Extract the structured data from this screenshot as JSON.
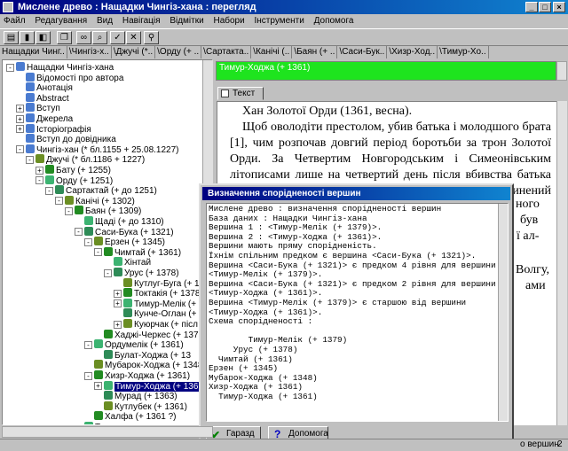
{
  "window": {
    "title": "Мислене древо : Нащадки Чингіз-хана : перегляд",
    "controls": [
      "_",
      "□",
      "×"
    ]
  },
  "menu": [
    "Файл",
    "Редагування",
    "Вид",
    "Навігація",
    "Відмітки",
    "Набори",
    "Інструменти",
    "Допомога"
  ],
  "tabs": [
    "Нащадки Чинг..",
    "\\Чингіз-х..",
    "\\Джучі (*..",
    "\\Орду (+ ..",
    "\\Сартакта..",
    "\\Канічі (..",
    "\\Баян (+ ..",
    "\\Саси-Бук..",
    "\\Хизр-Ход..",
    "\\Тимур-Хо.."
  ],
  "tree": {
    "items": [
      {
        "label": "Нащадки Чингіз-хана",
        "depth": 0,
        "exp": "-"
      },
      {
        "label": "Відомості про автора",
        "depth": 1
      },
      {
        "label": "Анотація",
        "depth": 1
      },
      {
        "label": "Abstract",
        "depth": 1
      },
      {
        "label": "Вступ",
        "depth": 1,
        "exp": "+"
      },
      {
        "label": "Джерела",
        "depth": 1,
        "exp": "+"
      },
      {
        "label": "Історіографія",
        "depth": 1,
        "exp": "+"
      },
      {
        "label": "Вступ до довідника",
        "depth": 1
      },
      {
        "label": "Чингіз-хан (* бл.1155 + 25.08.1227)",
        "depth": 1,
        "exp": "-"
      },
      {
        "label": "Джучі (* бл.1186 + 1227)",
        "depth": 2,
        "exp": "-"
      },
      {
        "label": "Бату (+ 1255)",
        "depth": 3,
        "exp": "+"
      },
      {
        "label": "Орду (+ 1251)",
        "depth": 3,
        "exp": "-"
      },
      {
        "label": "Сартактай (+ до 1251)",
        "depth": 4,
        "exp": "-"
      },
      {
        "label": "Канічі (+ 1302)",
        "depth": 5,
        "exp": "-"
      },
      {
        "label": "Баян (+ 1309)",
        "depth": 6,
        "exp": "-"
      },
      {
        "label": "Щаді (+ до 1310)",
        "depth": 7
      },
      {
        "label": "Саси-Бука (+ 1321)",
        "depth": 7,
        "exp": "-"
      },
      {
        "label": "Ерзен (+ 1345)",
        "depth": 8,
        "exp": "-"
      },
      {
        "label": "Чимтай (+ 1361)",
        "depth": 9,
        "exp": "-"
      },
      {
        "label": "Хінтай",
        "depth": 10
      },
      {
        "label": "Урус (+ 1378)",
        "depth": 10,
        "exp": "-"
      },
      {
        "label": "Кутлуг-Буга (+ 1361",
        "depth": 11
      },
      {
        "label": "Токтакія (+ 1378",
        "depth": 11,
        "exp": "+"
      },
      {
        "label": "Тимур-Мелік (+ 1379",
        "depth": 11,
        "exp": "+"
      },
      {
        "label": "Кунче-Оглан (+",
        "depth": 11
      },
      {
        "label": "Куюрчак (+ післ",
        "depth": 11,
        "exp": "+"
      },
      {
        "label": "Хаджі-Черкес (+ 1375",
        "depth": 9
      },
      {
        "label": "Ордумелік (+ 1361)",
        "depth": 8,
        "exp": "-"
      },
      {
        "label": "Булат-Ходжа (+ 13",
        "depth": 9
      },
      {
        "label": "Мубарок-Ходжа (+ 1348",
        "depth": 8
      },
      {
        "label": "Хизр-Ходжа (+ 1361)",
        "depth": 8,
        "exp": "-"
      },
      {
        "label": "Тимур-Ходжа (+ 1361",
        "depth": 9,
        "exp": "+",
        "selected": true
      },
      {
        "label": "Мурад (+ 1363)",
        "depth": 9
      },
      {
        "label": "Кутлубек (+ 1361)",
        "depth": 9
      },
      {
        "label": "Халфа (+ 1361 ?)",
        "depth": 8
      },
      {
        "label": "Теке",
        "depth": 7
      }
    ]
  },
  "header": {
    "current": "Тимур-Ходжа (+ 1361)"
  },
  "text_tab": {
    "label": "Текст"
  },
  "article": {
    "paragraphs": [
      "Хан Золотої Орди (1361, весна).",
      "Щоб оволодіти престолом, убив батька і молодшого брата [1], чим розпочав довгий період боротьби за трон Золотої Орди. За Четвертим Новгородським і Симеонівським літописами лише на четвертий день після вбивства батька був проголошений ханом, а на сьомий день скинений темником"
    ],
    "edge_fragments": [
      "ного",
      "був",
      "ї ал-",
      "Волгу,",
      "ами"
    ]
  },
  "dialog": {
    "title": "Визначення спорідненості вершин",
    "lines": [
      "Мислене древо : визначення спорідненості вершин",
      "База даних : Нащадки Чингіз-хана",
      "Вершина 1 : <Тимур-Мелік (+ 1379)>.",
      "Вершина 2 : <Тимур-Ходжа (+ 1361)>.",
      "Вершини мають пряму спорідненість.",
      "Їхнім спільним предком є вершина <Саси-Бука (+ 1321)>.",
      "Вершина <Саси-Бука (+ 1321)> є предком 4 рівня для вершини",
      "<Тимур-Мелік (+ 1379)>.",
      "Вершина <Саси-Бука (+ 1321)> є предком 2 рівня для вершини",
      "<Тимур-Ходжа (+ 1361)>.",
      "Вершина <Тимур-Мелік (+ 1379)> є старшою від вершини",
      "<Тимур-Ходжа (+ 1361)>.",
      "Схема спорідненості :",
      "",
      "        Тимур-Мелік (+ 1379)",
      "     Урус (+ 1378)",
      "  Чимтай (+ 1361)",
      "Ерзен (+ 1345)",
      "Мубарок-Ходжа (+ 1348)",
      "Хизр-Ходжа (+ 1361)",
      "  Тимур-Ходжа (+ 1361)"
    ],
    "ok_label": "Гаразд",
    "help_label": "Допомога"
  },
  "status": {
    "right_text": "о вершин",
    "page": "2"
  },
  "colors": {
    "title": "#000080",
    "green": "#1ee41e",
    "face": "#c0c0c0"
  }
}
